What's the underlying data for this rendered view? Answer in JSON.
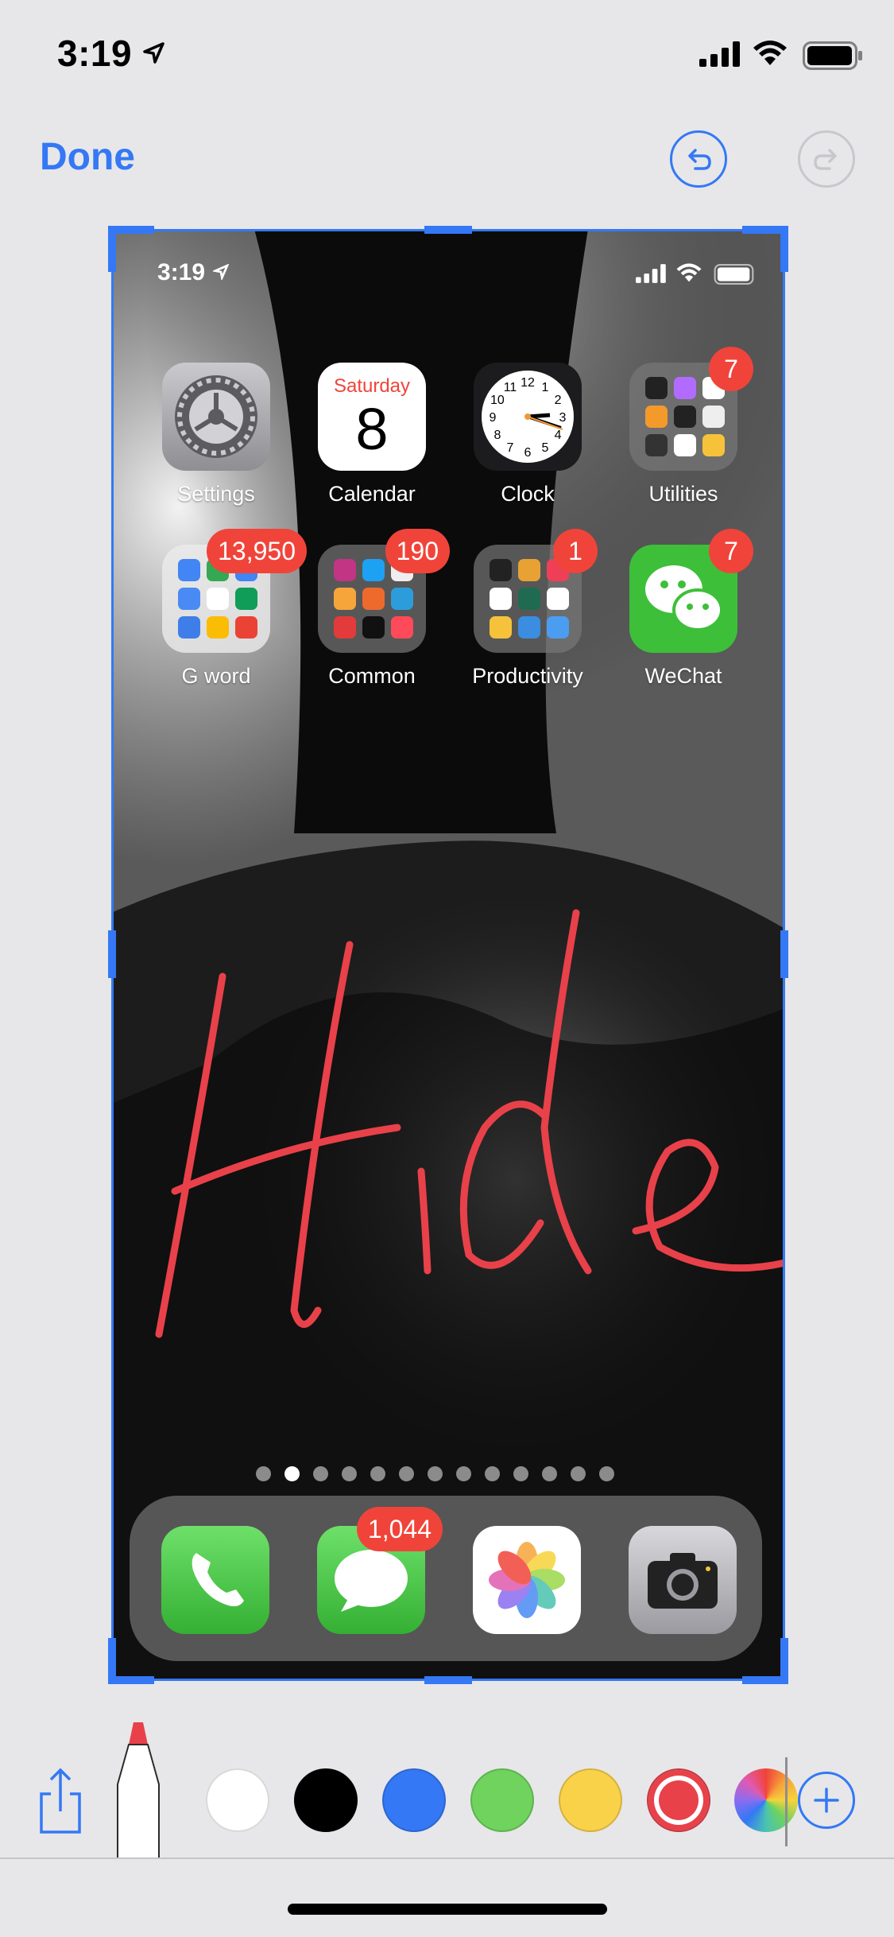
{
  "status_bar": {
    "time": "3:19"
  },
  "toolbar": {
    "done_label": "Done"
  },
  "screenshot": {
    "status_time": "3:19",
    "apps_row1": [
      {
        "label": "Settings",
        "badge": ""
      },
      {
        "label": "Calendar",
        "badge": "",
        "weekday": "Saturday",
        "day": "8"
      },
      {
        "label": "Clock",
        "badge": ""
      },
      {
        "label": "Utilities",
        "badge": "7"
      }
    ],
    "apps_row2": [
      {
        "label": "G word",
        "badge": "13,950"
      },
      {
        "label": "Common",
        "badge": "190"
      },
      {
        "label": "Productivity",
        "badge": "1"
      },
      {
        "label": "WeChat",
        "badge": "7"
      }
    ],
    "clock_numbers": [
      "12",
      "1",
      "2",
      "3",
      "4",
      "5",
      "6",
      "7",
      "8",
      "9",
      "10",
      "11"
    ],
    "page_dots": {
      "count": 13,
      "active_index": 1
    },
    "dock": [
      {
        "name": "phone",
        "badge": ""
      },
      {
        "name": "messages",
        "badge": "1,044"
      },
      {
        "name": "photos",
        "badge": ""
      },
      {
        "name": "camera",
        "badge": ""
      }
    ],
    "annotation_text": "Hide",
    "annotation_color": "#e8414a"
  },
  "palette": {
    "colors": [
      "#ffffff",
      "#000000",
      "#3478f6",
      "#6fd35e",
      "#f9d24a",
      "#e8414a"
    ],
    "selected_index": 5,
    "accent": "#3478f6"
  }
}
